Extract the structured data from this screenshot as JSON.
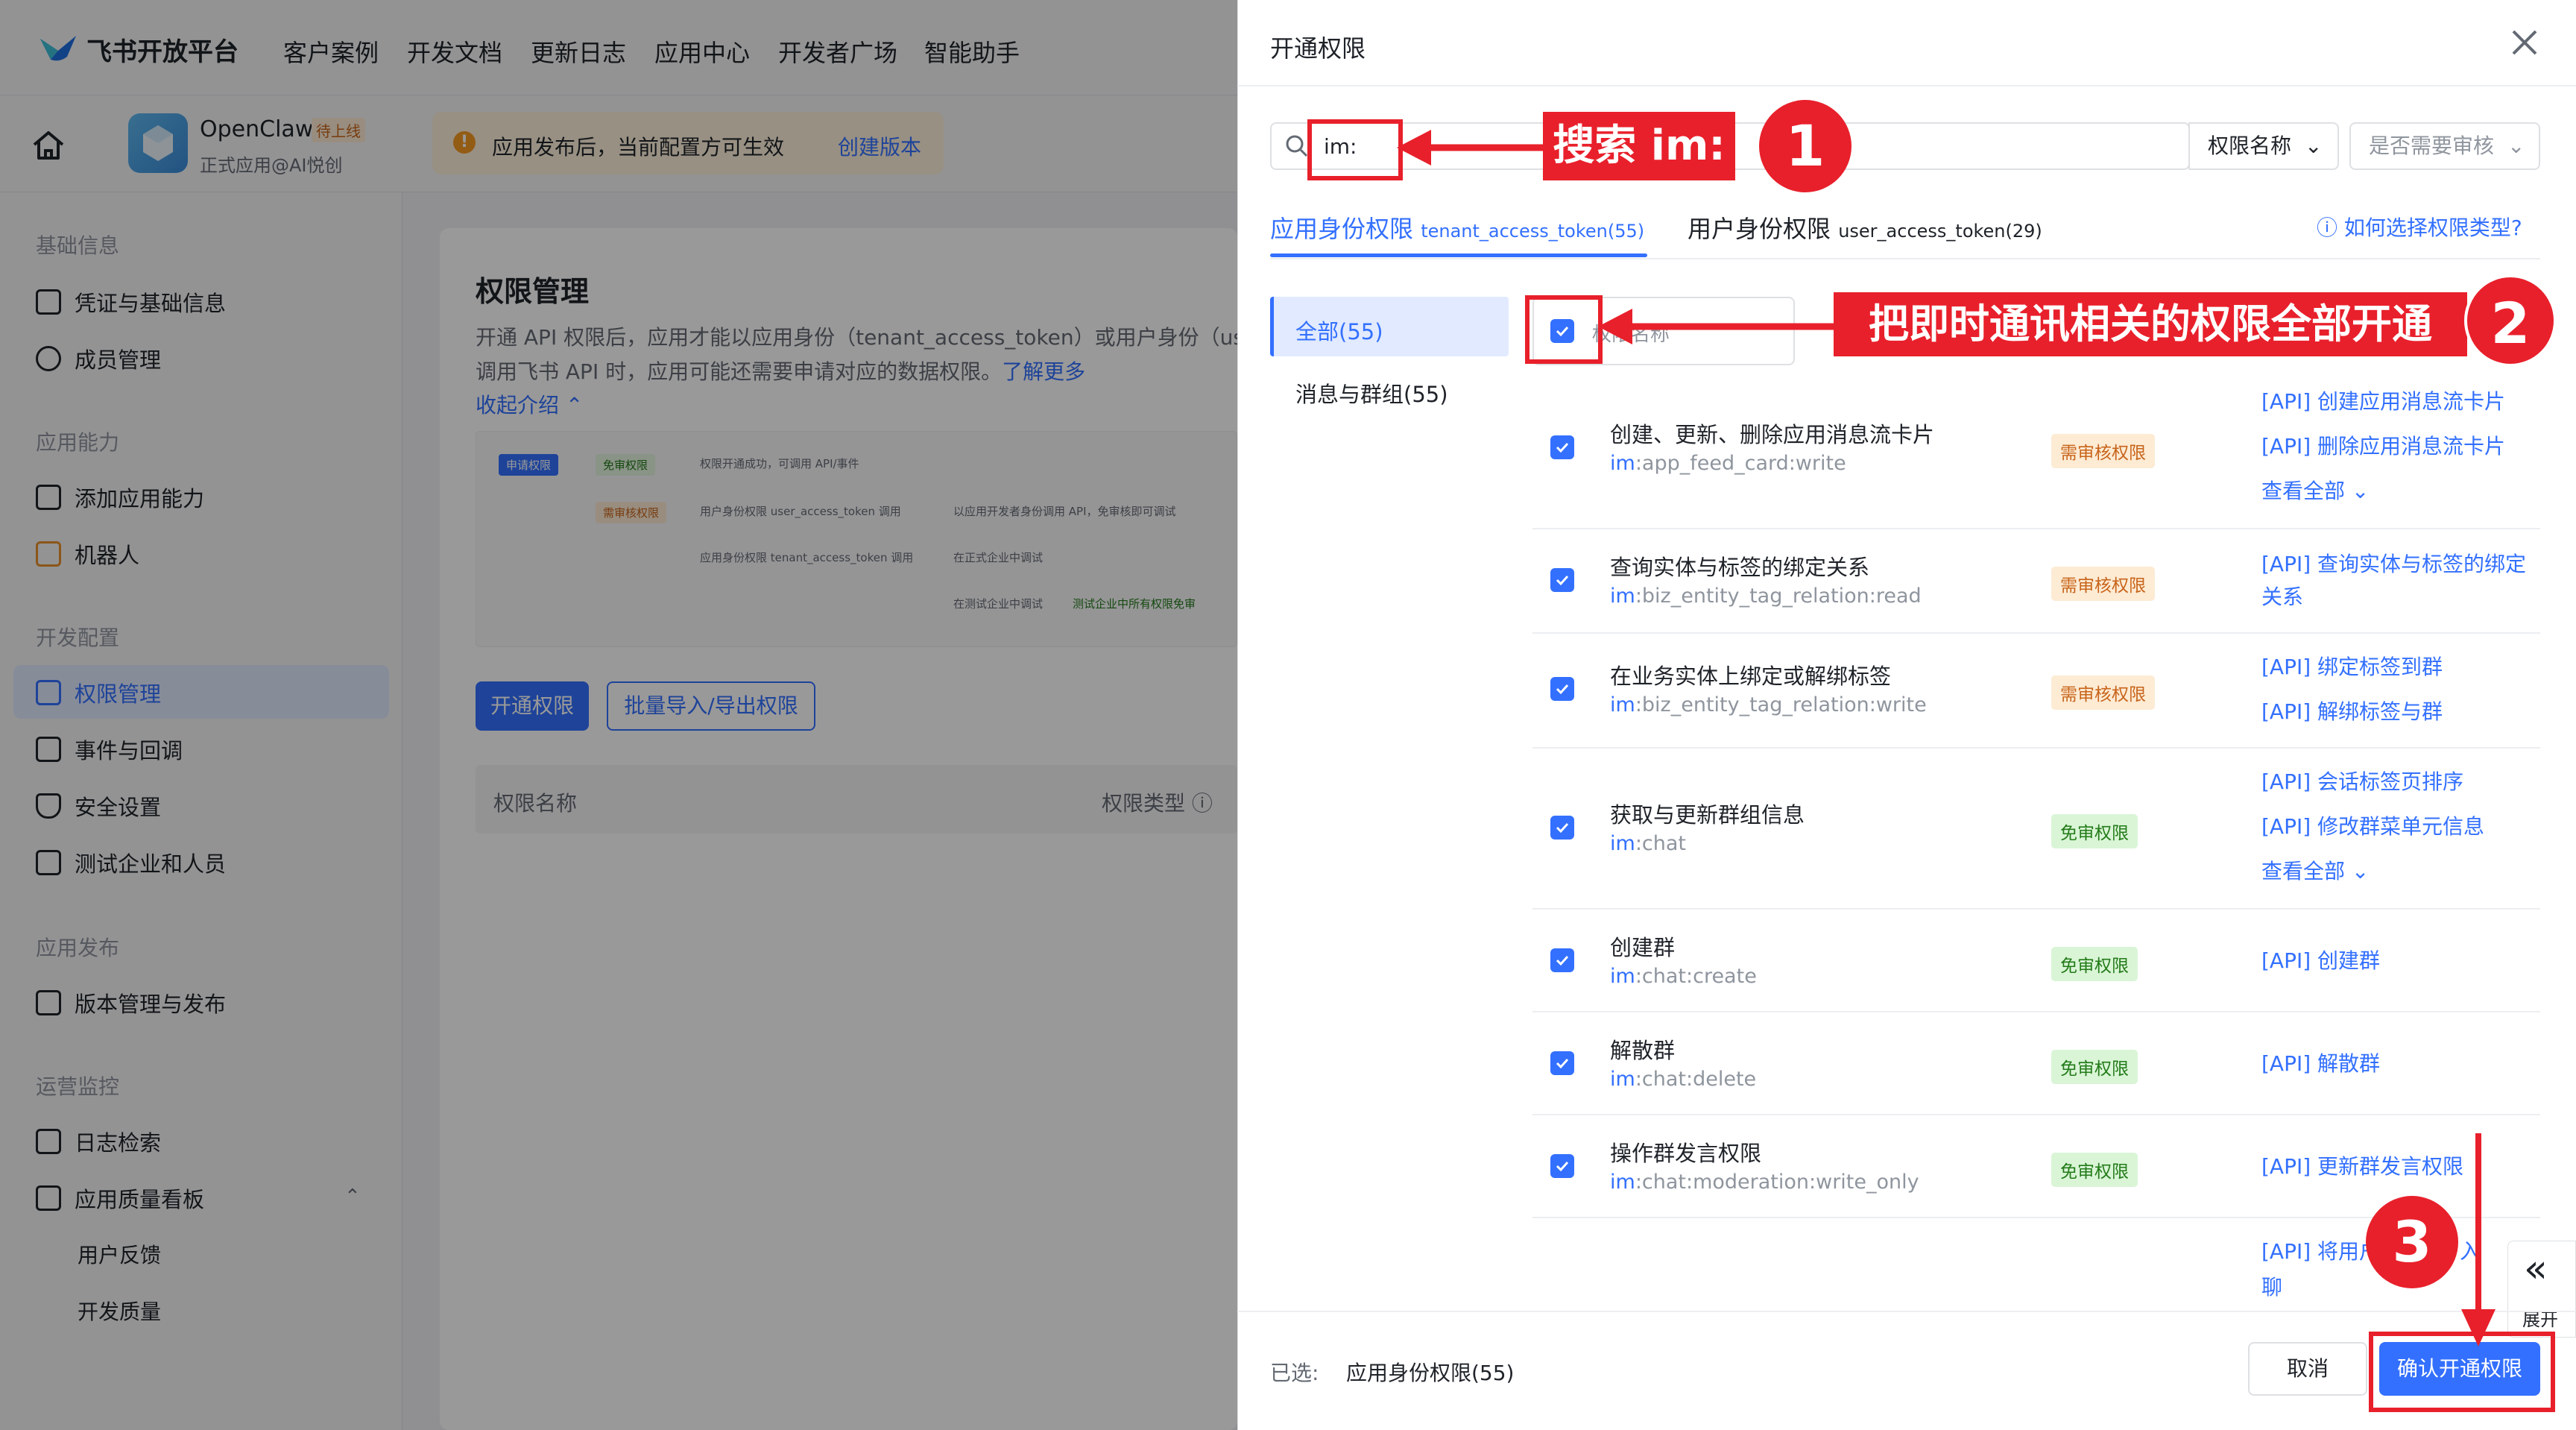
{
  "topnav": {
    "logo": "飞书开放平台",
    "items": [
      "客户案例",
      "开发文档",
      "更新日志",
      "应用中心",
      "开发者广场",
      "智能助手"
    ]
  },
  "app": {
    "name": "OpenClaw",
    "badge": "待上线",
    "sub": "正式应用@AI悦创"
  },
  "notice": {
    "text": "应用发布后，当前配置方可生效",
    "link": "创建版本"
  },
  "sidebar": {
    "sections": [
      "基础信息",
      "应用能力",
      "开发配置",
      "应用发布",
      "运营监控"
    ],
    "items": [
      "凭证与基础信息",
      "成员管理",
      "添加应用能力",
      "机器人",
      "权限管理",
      "事件与回调",
      "安全设置",
      "测试企业和人员",
      "版本管理与发布",
      "日志检索",
      "应用质量看板"
    ],
    "subitems": [
      "用户反馈",
      "开发质量"
    ]
  },
  "main": {
    "title": "权限管理",
    "desc1": "开通 API 权限后，应用才能以应用身份（tenant_access_token）或用户身份（use",
    "desc2": "调用飞书 API 时，应用可能还需要申请对应的数据权限。",
    "learn_more": "了解更多",
    "collapse": "收起介绍",
    "flow": {
      "t0": "申请权限",
      "t1": "免审权限",
      "t2": "权限开通成功，可调用 API/事件",
      "t3": "需审核权限",
      "t4": "用户身份权限 user_access_token 调用",
      "t5": "以应用开发者身份调用 API，免审核即可调试",
      "t6": "应用身份权限 tenant_access_token 调用",
      "t7": "在正式企业中调试",
      "t8": "在测试企业中调试",
      "t9": "测试企业中所有权限免审"
    },
    "btn_open": "开通权限",
    "btn_batch": "批量导入/导出权限",
    "col_name": "权限名称",
    "col_type": "权限类型"
  },
  "panel": {
    "title": "开通权限",
    "search_value": "im:",
    "select1": "权限名称",
    "select2": "是否需要审核",
    "tab1_label": "应用身份权限",
    "tab1_sub": "tenant_access_token(55)",
    "tab2_label": "用户身份权限",
    "tab2_sub": "user_access_token(29)",
    "help": "如何选择权限类型?",
    "cats": [
      "全部(55)",
      "消息与群组(55)"
    ],
    "header_label": "权限名称",
    "rows": [
      {
        "title": "创建、更新、删除应用消息流卡片",
        "prefix": "im",
        "code": ":app_feed_card:write",
        "tag": "需审核权限",
        "apis": [
          "[API] 创建应用消息流卡片",
          "[API] 删除应用消息流卡片",
          "查看全部"
        ]
      },
      {
        "title": "查询实体与标签的绑定关系",
        "prefix": "im",
        "code": ":biz_entity_tag_relation:read",
        "tag": "需审核权限",
        "apis": [
          "[API] 查询实体与标签的绑定",
          "关系"
        ]
      },
      {
        "title": "在业务实体上绑定或解绑标签",
        "prefix": "im",
        "code": ":biz_entity_tag_relation:write",
        "tag": "需审核权限",
        "apis": [
          "[API] 绑定标签到群",
          "[API] 解绑标签与群"
        ]
      },
      {
        "title": "获取与更新群组信息",
        "prefix": "im",
        "code": ":chat",
        "tag": "免审权限",
        "apis": [
          "[API] 会话标签页排序",
          "[API] 修改群菜单元信息",
          "查看全部"
        ]
      },
      {
        "title": "创建群",
        "prefix": "im",
        "code": ":chat:create",
        "tag": "免审权限",
        "apis": [
          "[API] 创建群"
        ]
      },
      {
        "title": "解散群",
        "prefix": "im",
        "code": ":chat:delete",
        "tag": "免审权限",
        "apis": [
          "[API] 解散群"
        ]
      },
      {
        "title": "操作群发言权限",
        "prefix": "im",
        "code": ":chat:moderation:write_only",
        "tag": "免审权限",
        "apis": [
          "[API] 更新群发言权限"
        ]
      }
    ],
    "partial_api1": "[API] 将用户",
    "partial_api2": "入",
    "partial_api3": "聊",
    "selected_label": "已选:",
    "selected_value": "应用身份权限(55)",
    "cancel": "取消",
    "confirm": "确认开通权限",
    "expand": "展开"
  },
  "annotations": {
    "a1": "搜索 im:",
    "n1": "1",
    "a2": "把即时通讯相关的权限全部开通",
    "n2": "2",
    "n3": "3"
  },
  "colors": {
    "accent": "#3370ff",
    "annotation_red": "#e8202b"
  }
}
